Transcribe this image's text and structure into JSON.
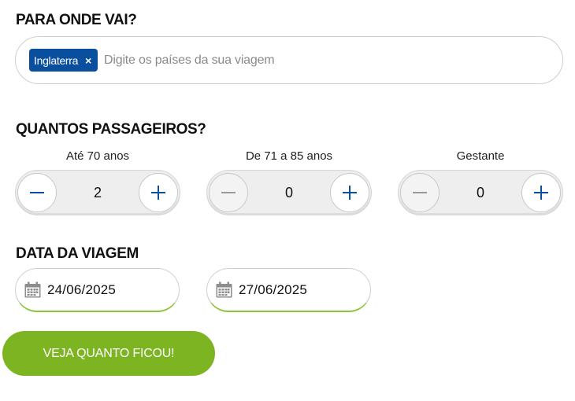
{
  "destination": {
    "title": "PARA ONDE VAI?",
    "chips": [
      {
        "label": "Inglaterra",
        "remove": "×"
      }
    ],
    "placeholder": "Digite os países da sua viagem"
  },
  "passengers": {
    "title": "QUANTOS PASSAGEIROS?",
    "groups": [
      {
        "label": "Até 70 anos",
        "value": "2",
        "minus_enabled": true
      },
      {
        "label": "De 71 a 85 anos",
        "value": "0",
        "minus_enabled": false
      },
      {
        "label": "Gestante",
        "value": "0",
        "minus_enabled": false
      }
    ]
  },
  "trip_dates": {
    "title": "DATA DA VIAGEM",
    "start": "24/06/2025",
    "end": "27/06/2025",
    "icon": "calendar-icon"
  },
  "cta": {
    "label": "VEJA QUANTO FICOU!"
  },
  "colors": {
    "accent_blue": "#0a4f9e",
    "accent_green": "#7db422"
  }
}
